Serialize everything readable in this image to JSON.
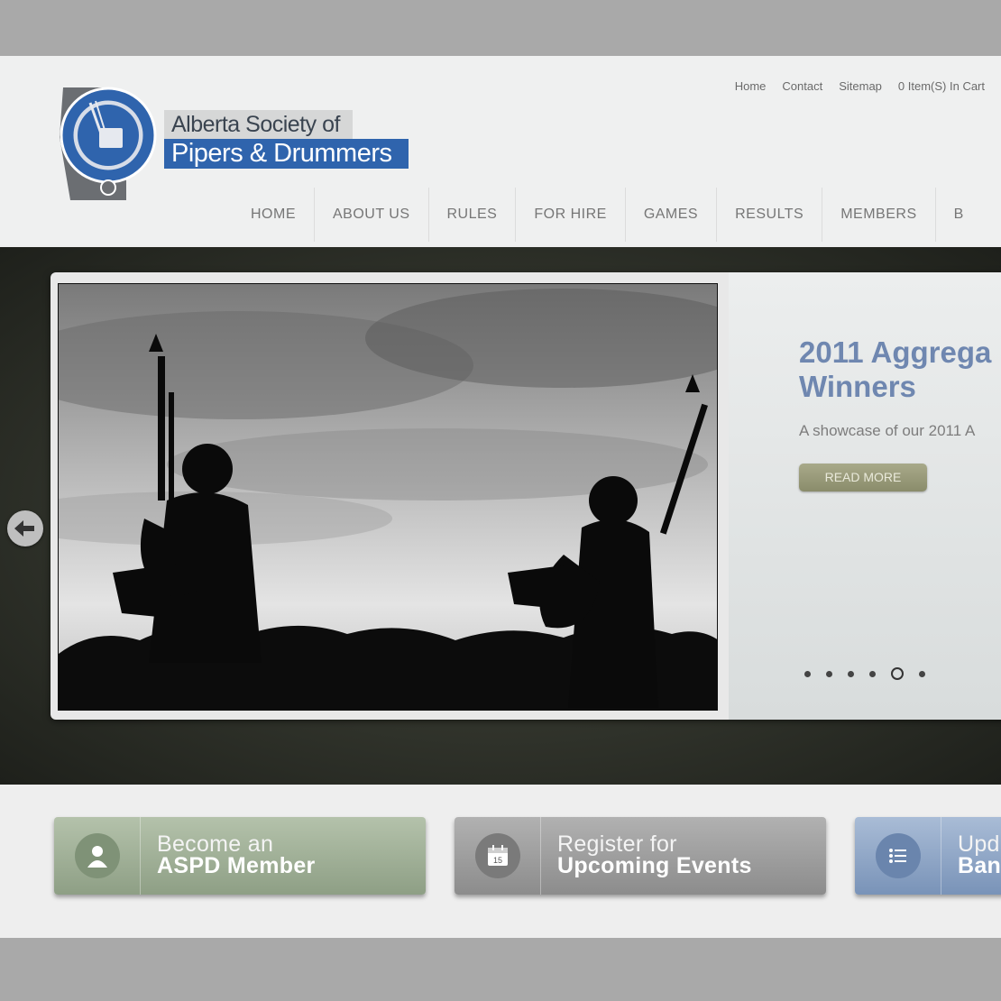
{
  "logo": {
    "line1": "Alberta Society of",
    "line2": "Pipers & Drummers"
  },
  "util_nav": [
    "Home",
    "Contact",
    "Sitemap",
    "0 Item(S) In Cart"
  ],
  "main_nav": [
    "HOME",
    "ABOUT US",
    "RULES",
    "FOR HIRE",
    "GAMES",
    "RESULTS",
    "MEMBERS",
    "B"
  ],
  "slide": {
    "title_line1": "2011 Aggrega",
    "title_line2": "Winners",
    "description": "A showcase of our 2011 A",
    "read_more": "READ MORE",
    "dot_count": 6,
    "active_dot": 5
  },
  "promos": [
    {
      "line1": "Become an",
      "line2": "ASPD Member",
      "icon": "member-icon"
    },
    {
      "line1": "Register for",
      "line2": "Upcoming Events",
      "icon": "calendar-icon",
      "calendar_day": "15"
    },
    {
      "line1": "Upd",
      "line2": "Ban",
      "icon": "list-icon"
    }
  ],
  "colors": {
    "logo_blue": "#2f64ad",
    "title_blue": "#6f87b0",
    "read_more": "#8a8c6b"
  }
}
